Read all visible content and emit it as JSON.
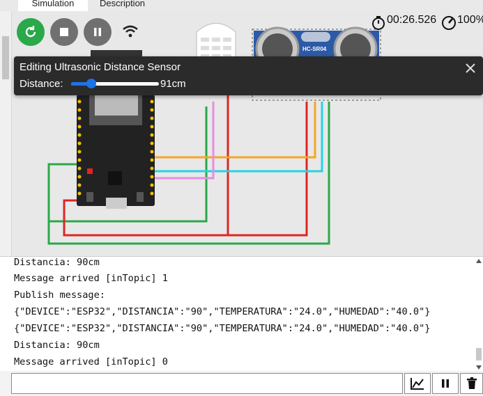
{
  "tabs": {
    "simulation": "Simulation",
    "description": "Description"
  },
  "timer": {
    "elapsed": "00:26.526",
    "speed": "100%"
  },
  "sensor": {
    "dht_label": "",
    "ultrasonic_label": "HC-SR04"
  },
  "popup": {
    "title": "Editing Ultrasonic Distance Sensor",
    "distance_label": "Distance:",
    "distance_value": "91cm",
    "slider_fraction": 0.23
  },
  "console": {
    "lines": [
      "Distancia: 90cm",
      "Message arrived [inTopic] 1",
      "Publish message:",
      "{\"DEVICE\":\"ESP32\",\"DISTANCIA\":\"90\",\"TEMPERATURA\":\"24.0\",\"HUMEDAD\":\"40.0\"}",
      "{\"DEVICE\":\"ESP32\",\"DISTANCIA\":\"90\",\"TEMPERATURA\":\"24.0\",\"HUMEDAD\":\"40.0\"}",
      "Distancia: 90cm",
      "Message arrived [inTopic] 0"
    ]
  },
  "input": {
    "value": ""
  },
  "colors": {
    "green": "#2aa84a",
    "red": "#e02424",
    "orange": "#f5a623",
    "cyan": "#22d3e6",
    "pink": "#e58ee0",
    "accent": "#1e73e8"
  }
}
